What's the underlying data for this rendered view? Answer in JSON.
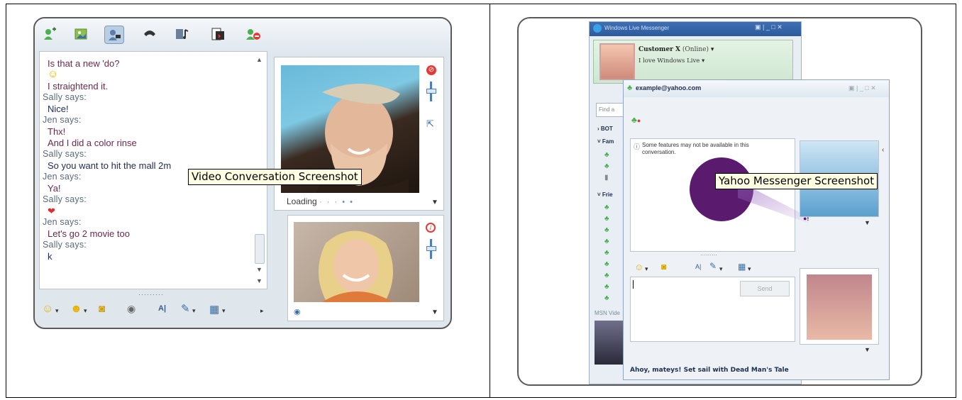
{
  "left": {
    "tooltip": "Video Conversation Screenshot",
    "chat": [
      {
        "kind": "msg",
        "text": "Is that a new 'do?",
        "pink": true
      },
      {
        "kind": "emoji",
        "text": "☺"
      },
      {
        "kind": "msg",
        "text": "I straightend it.",
        "pink": true
      },
      {
        "kind": "says",
        "text": "Sally says:"
      },
      {
        "kind": "msg",
        "text": "Nice!"
      },
      {
        "kind": "says",
        "text": "Jen says:"
      },
      {
        "kind": "msg",
        "text": "Thx!",
        "pink": true
      },
      {
        "kind": "msg",
        "text": "And I did a color rinse",
        "pink": true
      },
      {
        "kind": "says",
        "text": "Sally says:"
      },
      {
        "kind": "msg",
        "text": "So you want to hit the mall 2m"
      },
      {
        "kind": "says",
        "text": "Jen says:"
      },
      {
        "kind": "msg",
        "text": "Ya!",
        "pink": true
      },
      {
        "kind": "says",
        "text": "Sally says:"
      },
      {
        "kind": "lips",
        "text": "❤"
      },
      {
        "kind": "says",
        "text": "Jen says:"
      },
      {
        "kind": "msg",
        "text": "Let's go 2 movie too",
        "pink": true
      },
      {
        "kind": "says",
        "text": "Sally says:"
      },
      {
        "kind": "msg",
        "text": "k"
      }
    ],
    "video_status": "Loading",
    "toolbar_icons": [
      "add-contact-icon",
      "share-photos-icon",
      "video-call-icon",
      "phone-icon",
      "media-icon",
      "games-icon",
      "block-icon"
    ],
    "format_icons": [
      "emoticon-icon",
      "wink-icon",
      "nudge-icon",
      "voice-clip-icon",
      "font-icon",
      "background-icon",
      "more-icon"
    ]
  },
  "right": {
    "tooltip": "Yahoo Messenger Screenshot",
    "main_window_title": "Windows Live Messenger",
    "user_name": "Customer X",
    "user_status": "(Online)",
    "personal_message": "I love Windows Live",
    "search_placeholder": "Find a",
    "groups": [
      "BOT",
      "Fam",
      "Frie"
    ],
    "chat_title": "example@yahoo.com",
    "info_message": "Some features may not be available in this conversation.",
    "send_label": "Send",
    "msn_video_label": "MSN Vide",
    "ad_text": "Ahoy, mateys! Set sail with Dead Man's Tale"
  },
  "colors": {
    "accent": "#2b6cb0",
    "tooltip_bg": "#ffffe1",
    "yahoo_purple": "#5a1a6e"
  }
}
